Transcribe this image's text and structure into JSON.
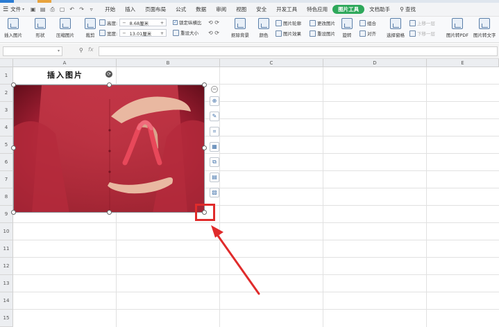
{
  "menubar": {
    "file_menu": "文件",
    "tabs": [
      "开始",
      "插入",
      "页面布局",
      "公式",
      "数据",
      "审阅",
      "视图",
      "安全",
      "开发工具",
      "特色应用",
      "图片工具",
      "文档助手"
    ],
    "active_tab": "图片工具",
    "search": "查找"
  },
  "ribbon": {
    "insert_picture": "插入图片",
    "shape": "形状",
    "compress": "压缩图片",
    "crop": "裁剪",
    "height_label": "高度:",
    "height_value": "8.68厘米",
    "width_label": "宽度:",
    "width_value": "13.01厘米",
    "lock_ratio": "锁定纵横比",
    "reset_size": "重设大小",
    "remove_bg": "抠除背景",
    "color": "颜色",
    "picture_outline": "图片轮廓",
    "picture_effect": "图片效果",
    "change_picture": "更改图片",
    "reset_picture": "重设图片",
    "rotate": "旋转",
    "group": "组合",
    "align": "对齐",
    "bring_forward": "上移一层",
    "send_backward": "下移一层",
    "selection_pane": "选择窗格",
    "to_pdf": "图片转PDF",
    "to_text": "图片转文字"
  },
  "formula_bar": {
    "name_box": "",
    "fx": "fx",
    "formula": ""
  },
  "sheet": {
    "columns": [
      "A",
      "B",
      "C",
      "D",
      "E"
    ],
    "rows": [
      "1",
      "2",
      "3",
      "4",
      "5",
      "6",
      "7",
      "8",
      "9",
      "10",
      "11",
      "12",
      "13",
      "14",
      "15"
    ],
    "cell_a1": "插入图片"
  },
  "picture": {
    "description_icon": "red-ribbon-photo",
    "ribbon_color": "#e8485a"
  },
  "float_toolbar": {
    "icons": [
      "collapse-icon",
      "zoom-icon",
      "remove-bg-icon",
      "crop-icon",
      "picture-outline-icon",
      "change-picture-icon",
      "ocr-icon",
      "picture-effect-icon"
    ]
  },
  "annotation": {
    "color": "#e02b2b"
  }
}
